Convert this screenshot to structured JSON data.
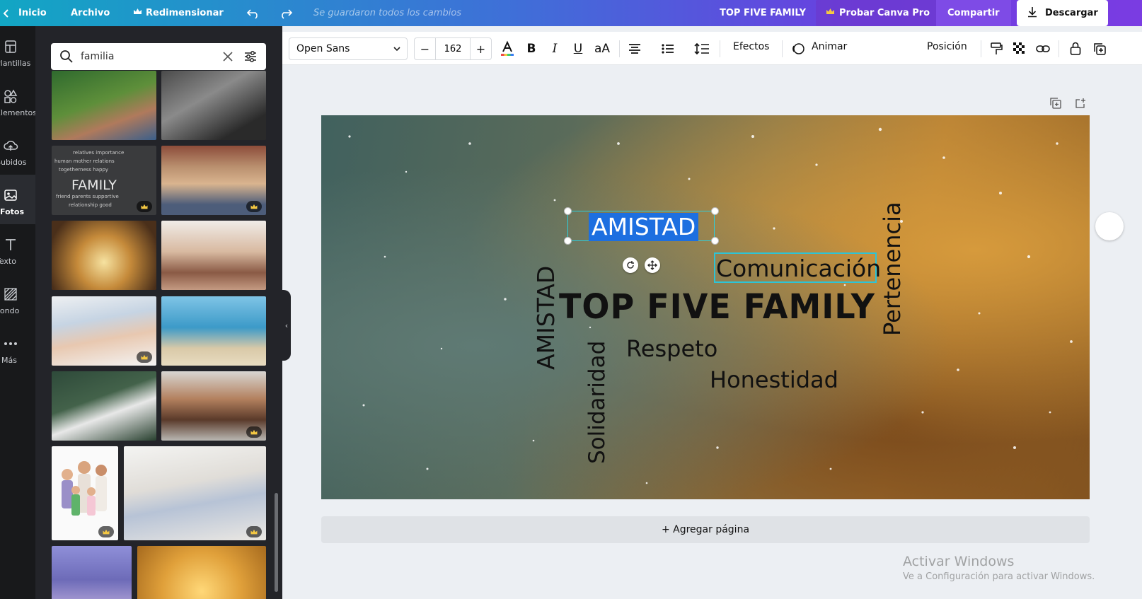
{
  "topbar": {
    "home": "Inicio",
    "file": "Archivo",
    "resize": "Redimensionar",
    "saved": "Se guardaron todos los cambios",
    "doc_title": "TOP FIVE FAMILY",
    "try_pro": "Probar Canva Pro",
    "share": "Compartir",
    "download": "Descargar"
  },
  "rail": {
    "items": [
      {
        "label": "Plantillas",
        "icon": "layout-icon"
      },
      {
        "label": "Elementos",
        "icon": "shapes-icon"
      },
      {
        "label": "Subidos",
        "icon": "cloud-upload-icon"
      },
      {
        "label": "Fotos",
        "icon": "image-icon"
      },
      {
        "label": "Texto",
        "icon": "text-icon"
      },
      {
        "label": "Fondo",
        "icon": "pattern-icon"
      },
      {
        "label": "Más",
        "icon": "more-icon"
      }
    ],
    "active": "Fotos"
  },
  "panel": {
    "search_value": "familia",
    "photos": [
      {
        "name": "hands-together",
        "premium": false
      },
      {
        "name": "family-couch-bw",
        "premium": false
      },
      {
        "name": "family-word-cloud",
        "premium": true
      },
      {
        "name": "family-portrait-outdoor",
        "premium": true
      },
      {
        "name": "heart-hands-sunset",
        "premium": false
      },
      {
        "name": "family-sofa",
        "premium": false
      },
      {
        "name": "father-daughter-laughing",
        "premium": true
      },
      {
        "name": "beach-heart-arms",
        "premium": false
      },
      {
        "name": "family-hug-living-room",
        "premium": false
      },
      {
        "name": "happy-family-closeup",
        "premium": true
      },
      {
        "name": "3d-cartoon-family",
        "premium": true
      },
      {
        "name": "pillow-fight",
        "premium": true
      },
      {
        "name": "purple-sky",
        "premium": false
      },
      {
        "name": "golden-glow",
        "premium": false
      }
    ]
  },
  "toolbar": {
    "font": "Open Sans",
    "size": "162",
    "minus": "−",
    "plus": "+",
    "bold": "B",
    "italic": "I",
    "underline": "U",
    "case": "aA",
    "effects": "Efectos",
    "animate": "Animar",
    "position": "Posición"
  },
  "canvas": {
    "selected_text": "AMISTAD",
    "title": "TOP FIVE FAMILY",
    "words": {
      "comunicacion": "Comunicación",
      "respeto": "Respeto",
      "honestidad": "Honestidad",
      "amistad_vertical": "AMISTAD",
      "solidaridad": "Solidaridad",
      "pertenencia": "Pertenencia"
    },
    "colors": {
      "text": "#111111",
      "selection": "#2dd0df",
      "highlight": "#1d6fe0"
    }
  },
  "add_page": "+ Agregar página",
  "watermark": {
    "line1": "Activar Windows",
    "line2": "Ve a Configuración para activar Windows."
  }
}
